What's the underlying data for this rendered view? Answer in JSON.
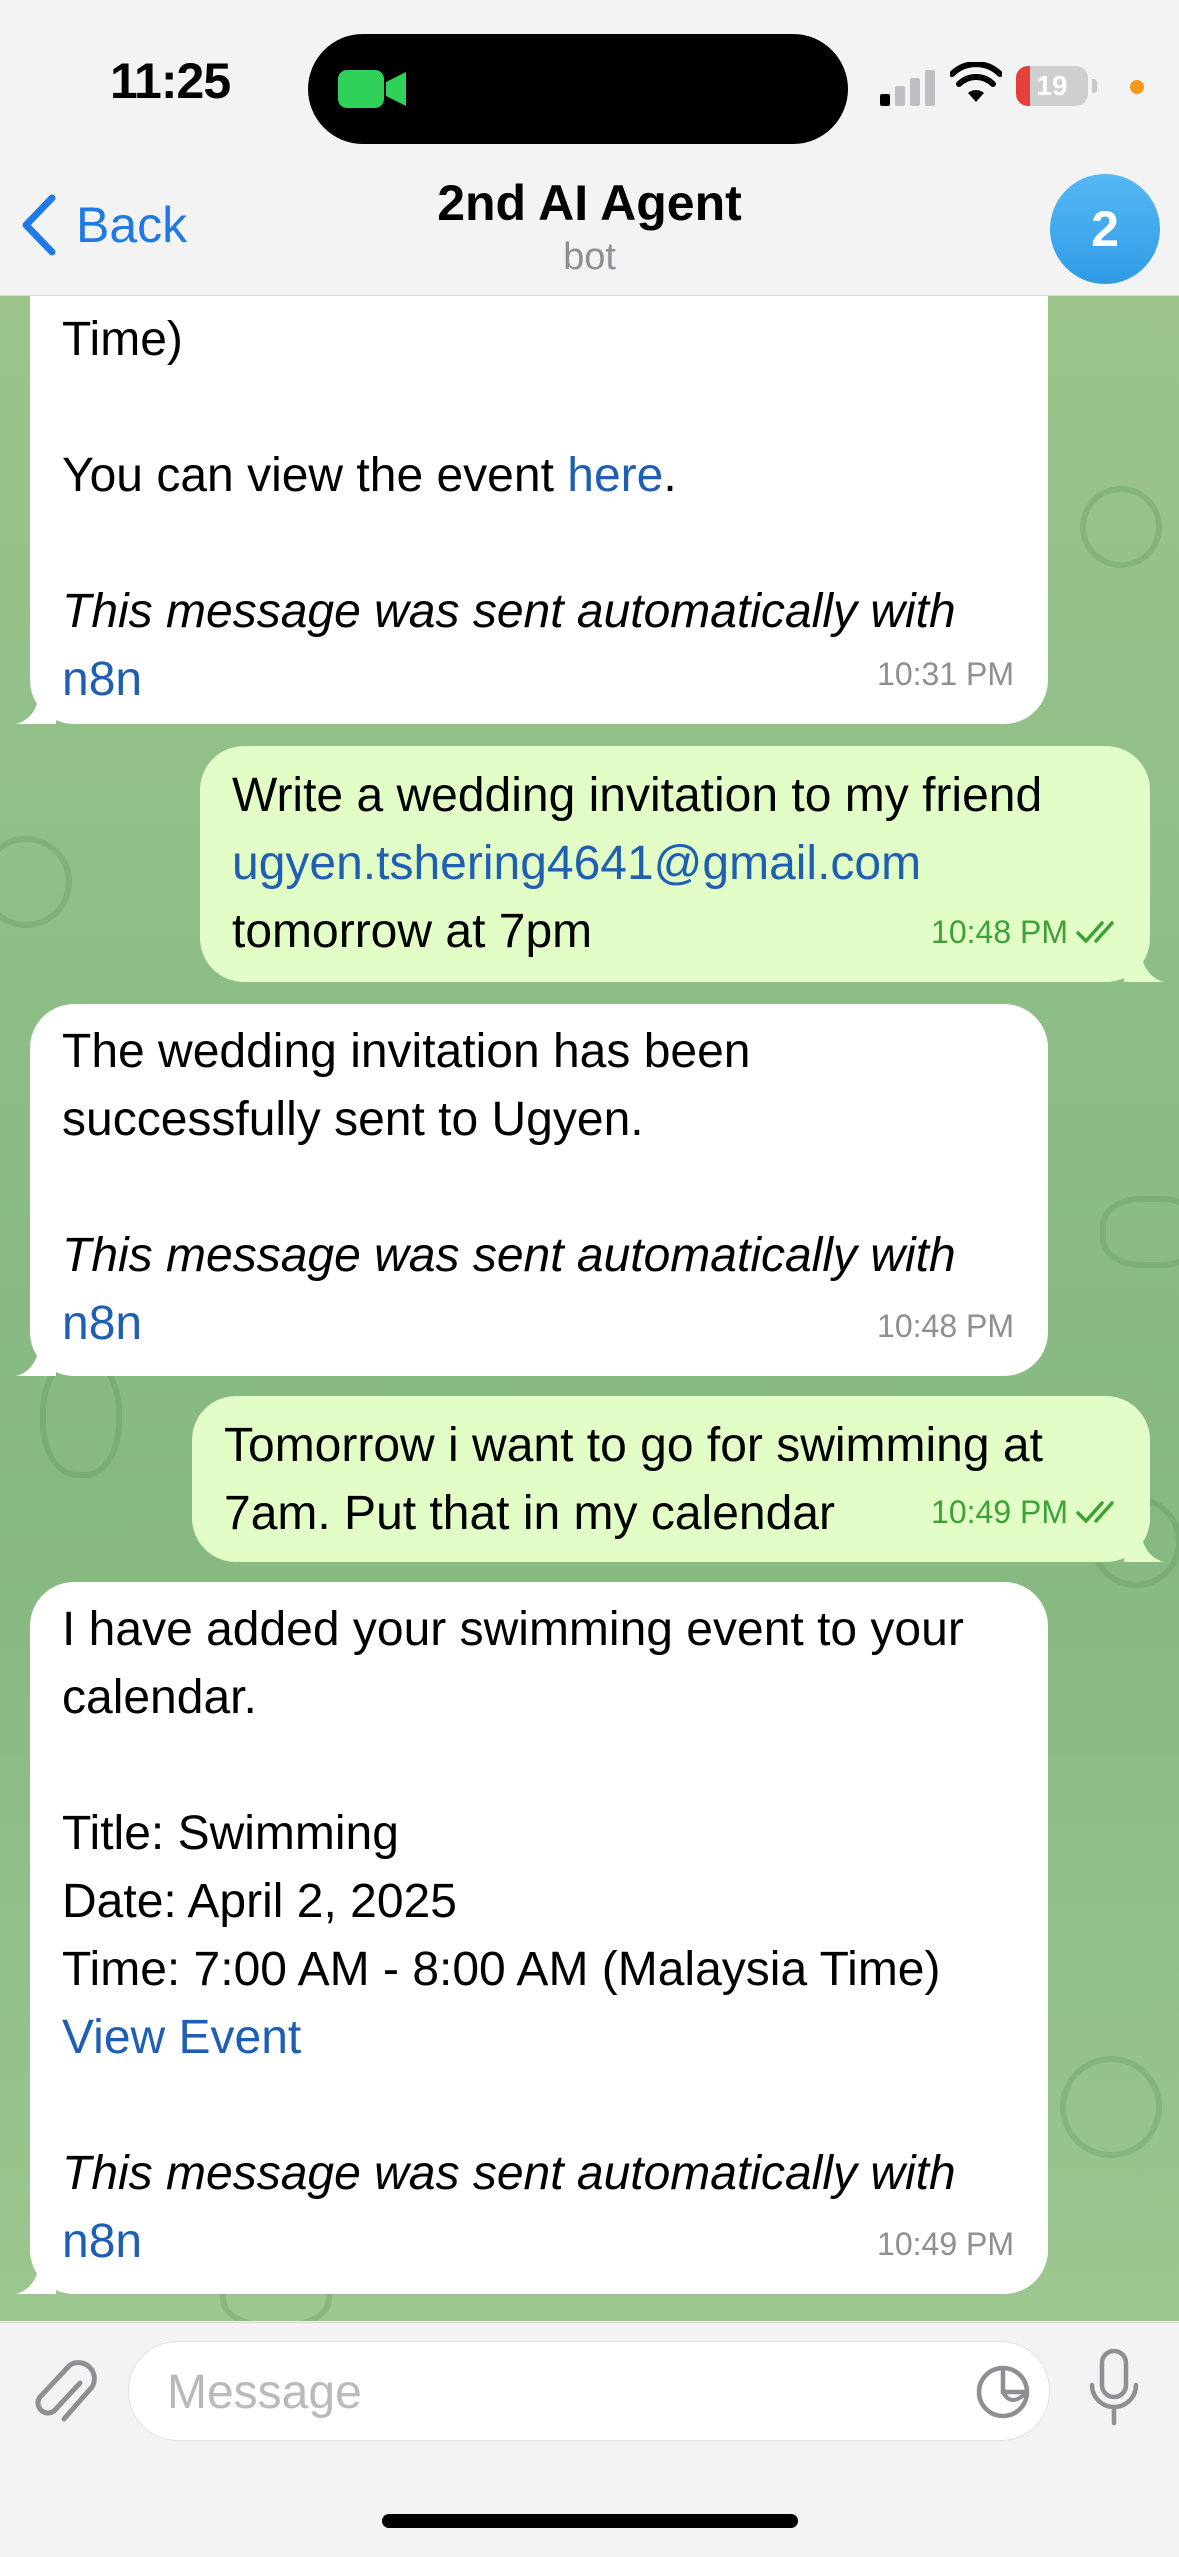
{
  "status_bar": {
    "time": "11:25",
    "battery_level": "19",
    "icons": [
      "facetime-camera-icon",
      "cellular-signal-icon",
      "wifi-icon",
      "battery-icon",
      "privacy-dot-icon"
    ]
  },
  "header": {
    "back_label": "Back",
    "title": "2nd AI Agent",
    "subtitle": "bot",
    "avatar_badge": "2"
  },
  "messages": [
    {
      "direction": "incoming",
      "line1": "Time)",
      "line2_prefix": "You can view the event ",
      "line2_link": "here",
      "line2_suffix": ".",
      "footer_italic": "This message was sent automatically with",
      "footer_link": "n8n",
      "time": "10:31 PM"
    },
    {
      "direction": "outgoing",
      "line1": "Write a wedding invitation to my friend",
      "line2_link": "ugyen.tshering4641@gmail.com",
      "line3": "tomorrow at 7pm",
      "time": "10:48 PM",
      "status": "read"
    },
    {
      "direction": "incoming",
      "line1": "The wedding invitation has been",
      "line2": "successfully sent to Ugyen.",
      "footer_italic": "This message was sent automatically with",
      "footer_link": "n8n",
      "time": "10:48 PM"
    },
    {
      "direction": "outgoing",
      "line1": "Tomorrow i want to go for swimming at",
      "line2": "7am. Put that in my calendar",
      "time": "10:49 PM",
      "status": "read"
    },
    {
      "direction": "incoming",
      "line1": "I have added your swimming event to your",
      "line2": "calendar.",
      "line3": "Title: Swimming",
      "line4": "Date: April 2, 2025",
      "line5": "Time: 7:00 AM - 8:00 AM (Malaysia Time)",
      "line6_link": "View Event",
      "footer_italic": "This message was sent automatically with",
      "footer_link": "n8n",
      "time": "10:49 PM"
    }
  ],
  "composer": {
    "placeholder": "Message",
    "icons": [
      "paperclip-icon",
      "sticker-icon",
      "microphone-icon"
    ]
  },
  "colors": {
    "accent": "#1f7ae6",
    "link": "#1e5fb4",
    "outgoing_bubble": "#e2fec6",
    "incoming_bubble": "#ffffff",
    "read_check": "#3da236",
    "chat_background": "#8fbf88"
  }
}
